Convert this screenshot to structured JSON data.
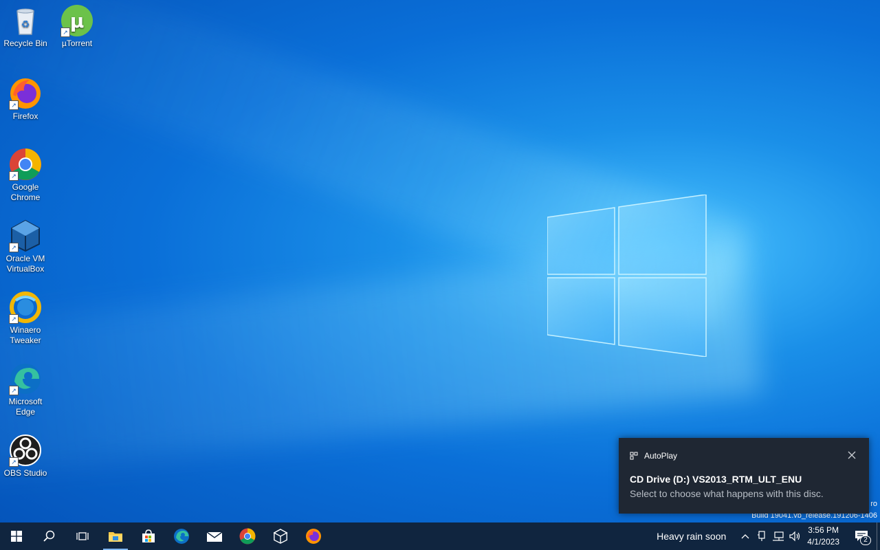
{
  "desktop": {
    "icons": [
      {
        "label": "Recycle Bin",
        "icon": "recycle-bin-icon"
      },
      {
        "label": "µTorrent",
        "icon": "utorrent-icon"
      },
      {
        "label": "Firefox",
        "icon": "firefox-icon"
      },
      {
        "label": "Google Chrome",
        "icon": "chrome-icon"
      },
      {
        "label": "Oracle VM VirtualBox",
        "icon": "virtualbox-icon"
      },
      {
        "label": "Winaero Tweaker",
        "icon": "winaero-icon"
      },
      {
        "label": "Microsoft Edge",
        "icon": "edge-icon"
      },
      {
        "label": "OBS Studio",
        "icon": "obs-icon"
      }
    ]
  },
  "toast": {
    "app": "AutoPlay",
    "title": "CD Drive (D:) VS2013_RTM_ULT_ENU",
    "body": "Select to choose what happens with this disc."
  },
  "watermark": {
    "line1": "ro",
    "line2": "Build 19041.vb_release.191206-1406"
  },
  "taskbar": {
    "buttons": [
      "start-icon",
      "search-icon",
      "task-view-icon",
      "file-explorer-icon",
      "store-icon",
      "edge-icon",
      "mail-icon",
      "chrome-icon",
      "virtualbox-icon",
      "firefox-icon"
    ],
    "weather": "Heavy rain soon",
    "time": "3:56 PM",
    "date": "4/1/2023",
    "notification_count": "2"
  },
  "colors": {
    "taskbar": "#10253f",
    "toast_bg": "#1f2733",
    "accent": "#0a6fd8"
  }
}
